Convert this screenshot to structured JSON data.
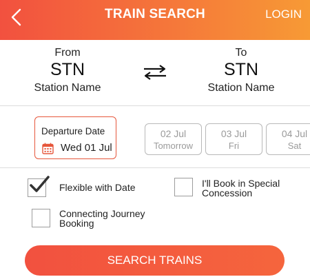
{
  "header": {
    "title": "TRAIN SEARCH",
    "login_label": "LOGIN",
    "back_icon": "chevron-left-icon"
  },
  "stations": {
    "from": {
      "label": "From",
      "code": "STN",
      "name": "Station Name"
    },
    "to": {
      "label": "To",
      "code": "STN",
      "name": "Station Name"
    },
    "swap_icon": "swap-arrows-icon"
  },
  "departure": {
    "label": "Departure Date",
    "value": "Wed 01 Jul",
    "icon": "calendar-icon"
  },
  "date_chips": [
    {
      "date": "02 Jul",
      "day": "Tomorrow"
    },
    {
      "date": "03 Jul",
      "day": "Fri"
    },
    {
      "date": "04 Jul",
      "day": "Sat"
    }
  ],
  "options": {
    "flexible": {
      "label": "Flexible with Date",
      "checked": true
    },
    "concession": {
      "line1": "I'll Book in Special",
      "line2": "Concession",
      "checked": false
    },
    "connecting": {
      "line1": "Connecting Journey",
      "line2": "Booking",
      "checked": false
    }
  },
  "search_button": {
    "label": "SEARCH TRAINS"
  },
  "colors": {
    "brand_start": "#f2513f",
    "brand_end": "#f79a35",
    "accent_border": "#e6563b",
    "inactive_text": "#9a9a9a"
  }
}
